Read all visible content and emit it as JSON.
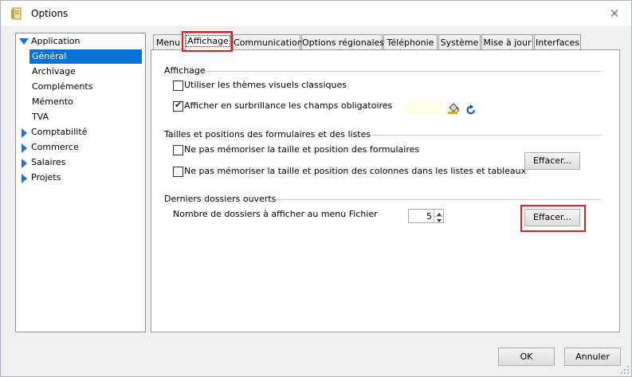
{
  "window": {
    "title": "Options"
  },
  "tree": {
    "items": [
      {
        "label": "Application",
        "expanded": true
      },
      {
        "label": "Général",
        "selected": true
      },
      {
        "label": "Archivage"
      },
      {
        "label": "Compléments"
      },
      {
        "label": "Mémento"
      },
      {
        "label": "TVA"
      },
      {
        "label": "Comptabilité"
      },
      {
        "label": "Commerce"
      },
      {
        "label": "Salaires"
      },
      {
        "label": "Projets"
      }
    ]
  },
  "tabs": [
    {
      "label": "Menu"
    },
    {
      "label": "Affichage",
      "active": true
    },
    {
      "label": "Communication"
    },
    {
      "label": "Options régionales"
    },
    {
      "label": "Téléphonie"
    },
    {
      "label": "Système"
    },
    {
      "label": "Mise à jour"
    },
    {
      "label": "Interfaces"
    }
  ],
  "affichage": {
    "group_label": "Affichage",
    "classic_themes_label": "Utiliser les thèmes visuels classiques",
    "classic_themes_checked": false,
    "highlight_required_label": "Afficher en surbrillance les champs obligatoires",
    "highlight_required_checked": true,
    "highlight_color": "#ffffe6"
  },
  "sizes": {
    "group_label": "Tailles et positions des formulaires et des listes",
    "forms_label": "Ne pas mémoriser la taille et position des formulaires",
    "forms_checked": false,
    "columns_label": "Ne pas mémoriser la taille et position des colonnes dans les listes et tableaux",
    "columns_checked": false,
    "clear_button": "Effacer..."
  },
  "recent": {
    "group_label": "Derniers dossiers ouverts",
    "count_label": "Nombre de dossiers à afficher au menu Fichier",
    "count_value": "5",
    "clear_button": "Effacer..."
  },
  "footer": {
    "ok": "OK",
    "cancel": "Annuler"
  },
  "colors": {
    "selection": "#0a71d6",
    "highlight_box": "#e31b1b",
    "tree_arrow": "#1a78d2"
  }
}
